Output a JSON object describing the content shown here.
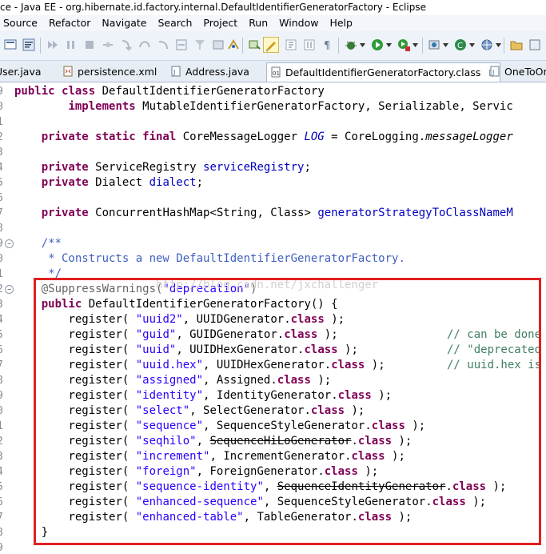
{
  "window": {
    "title": "ce - Java EE - org.hibernate.id.factory.internal.DefaultIdentifierGeneratorFactory - Eclipse"
  },
  "menu": [
    "Source",
    "Refactor",
    "Navigate",
    "Search",
    "Project",
    "Run",
    "Window",
    "Help"
  ],
  "tabs": [
    {
      "label": "User.java",
      "shown": "User.java"
    },
    {
      "label": "persistence.xml"
    },
    {
      "label": "Address.java"
    },
    {
      "label": "DefaultIdentifierGeneratorFactory.class",
      "close": "☒"
    },
    {
      "label": "OneToOn"
    }
  ],
  "watermark": "http://blog.csdn.net/jxchallenger",
  "line_numbers": [
    "9",
    "0",
    "1",
    "2",
    "3",
    "4",
    "5",
    "6",
    "7",
    "8",
    "9",
    "0",
    "1",
    "2",
    "3",
    "4",
    "5",
    "6",
    "7",
    "8",
    "9",
    "0",
    "1",
    "2",
    "3",
    "4",
    "5",
    "6",
    "7",
    "8",
    "9"
  ],
  "code": {
    "l0_kw1": "public",
    "l0_kw2": "class",
    "l0_rest": " DefaultIdentifierGeneratorFactory",
    "l1_kw": "implements",
    "l1_rest": " MutableIdentifierGeneratorFactory, Serializable, Servic",
    "l3_kw": "private static final",
    "l3_type": " CoreMessageLogger ",
    "l3_field": "LOG",
    "l3_eq": " = CoreLogging.",
    "l3_call": "messageLogger",
    "l5_kw": "private",
    "l5_type": " ServiceRegistry ",
    "l5_field": "serviceRegistry",
    "l5_end": ";",
    "l6_kw": "private",
    "l6_type": " Dialect ",
    "l6_field": "dialect",
    "l6_end": ";",
    "l8_kw": "private",
    "l8_type": " ConcurrentHashMap<String, Class> ",
    "l8_field": "generatorStrategyToClassNameM",
    "l10": "/**",
    "l11": " * Constructs a new DefaultIdentifierGeneratorFactory.",
    "l12": " */",
    "l13_ann": "@SuppressWarnings(",
    "l13_str": "\"deprecation\"",
    "l13_end": ")",
    "l14_kw": "public",
    "l14_rest": " DefaultIdentifierGeneratorFactory() {",
    "registers": [
      {
        "name": "\"uuid2\"",
        "cls": "UUIDGenerator",
        "comment": ""
      },
      {
        "name": "\"guid\"",
        "cls": "GUIDGenerator",
        "comment": "// can be done"
      },
      {
        "name": "\"uuid\"",
        "cls": "UUIDHexGenerator",
        "comment": "// \"deprecated"
      },
      {
        "name": "\"uuid.hex\"",
        "cls": "UUIDHexGenerator",
        "comment": "// uuid.hex is"
      },
      {
        "name": "\"assigned\"",
        "cls": "Assigned",
        "comment": ""
      },
      {
        "name": "\"identity\"",
        "cls": "IdentityGenerator",
        "comment": ""
      },
      {
        "name": "\"select\"",
        "cls": "SelectGenerator",
        "comment": ""
      },
      {
        "name": "\"sequence\"",
        "cls": "SequenceStyleGenerator",
        "comment": ""
      },
      {
        "name": "\"seqhilo\"",
        "cls": "SequenceHiLoGenerator",
        "comment": "",
        "deprecated": true
      },
      {
        "name": "\"increment\"",
        "cls": "IncrementGenerator",
        "comment": ""
      },
      {
        "name": "\"foreign\"",
        "cls": "ForeignGenerator",
        "comment": ""
      },
      {
        "name": "\"sequence-identity\"",
        "cls": "SequenceIdentityGenerator",
        "comment": "",
        "deprecated": true
      },
      {
        "name": "\"enhanced-sequence\"",
        "cls": "SequenceStyleGenerator",
        "comment": ""
      },
      {
        "name": "\"enhanced-table\"",
        "cls": "TableGenerator",
        "comment": ""
      }
    ],
    "close_brace": "}",
    "register_kw": "register(",
    "class_kw": "class",
    "register_end": " );"
  }
}
